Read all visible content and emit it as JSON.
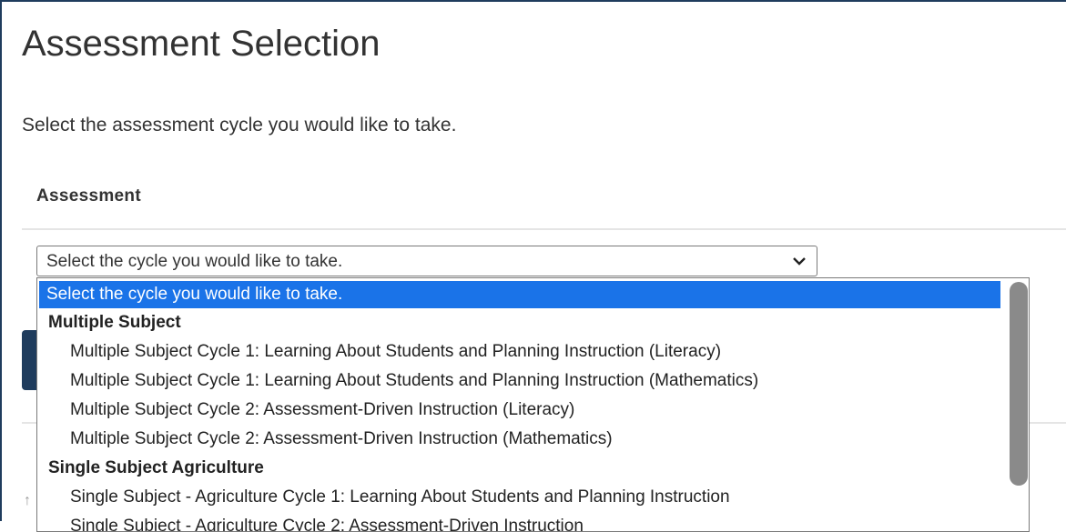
{
  "page": {
    "title": "Assessment Selection",
    "instruction": "Select the assessment cycle you would like to take.",
    "section_label": "Assessment"
  },
  "select": {
    "selected": "Select the cycle you would like to take."
  },
  "dropdown": {
    "placeholder": "Select the cycle you would like to take.",
    "groups": [
      {
        "label": "Multiple Subject",
        "options": [
          "Multiple Subject Cycle 1: Learning About Students and Planning Instruction (Literacy)",
          "Multiple Subject Cycle 1: Learning About Students and Planning Instruction (Mathematics)",
          "Multiple Subject Cycle 2: Assessment-Driven Instruction (Literacy)",
          "Multiple Subject Cycle 2: Assessment-Driven Instruction (Mathematics)"
        ]
      },
      {
        "label": "Single Subject Agriculture",
        "options": [
          "Single Subject - Agriculture Cycle 1: Learning About Students and Planning Instruction",
          "Single Subject - Agriculture Cycle 2: Assessment-Driven Instruction"
        ]
      }
    ]
  },
  "icons": {
    "chevron": "chevron-down-icon",
    "up_arrow": "arrow-up-icon",
    "up_arrow_glyph": "↑"
  },
  "colors": {
    "frame_border": "#1f3c5d",
    "highlight": "#1a73e8",
    "text": "#333333"
  }
}
